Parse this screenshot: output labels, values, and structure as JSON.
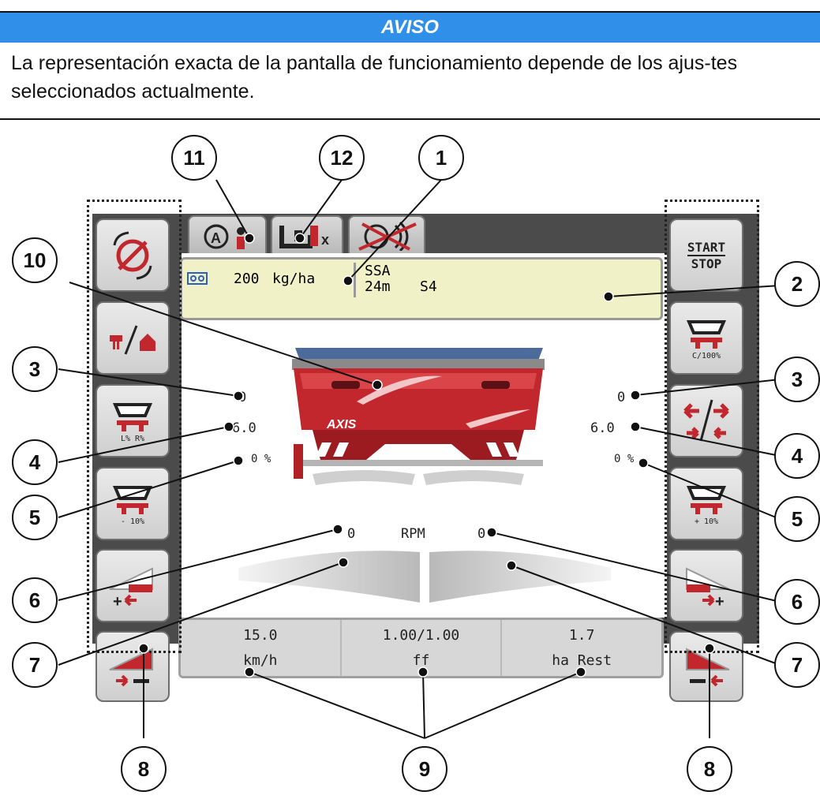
{
  "notice": {
    "title": "AVISO",
    "text": "La representación exacta de la pantalla de funcionamiento depende de los ajus-tes seleccionados actualmente."
  },
  "info_panel": {
    "rate": "200",
    "rate_unit": "kg/ha",
    "fertilizer": "SSA",
    "width": "24m",
    "disc": "S4"
  },
  "left_buttons": [
    {
      "icon": "stop-spinning-discs-icon",
      "label": ""
    },
    {
      "icon": "field-home-switch-icon",
      "label": ""
    },
    {
      "icon": "spreader-left-right-icon",
      "label": "L% R%"
    },
    {
      "icon": "spreader-minus-icon",
      "label": "- 10%"
    },
    {
      "icon": "section-increase-left-icon",
      "label": ""
    },
    {
      "icon": "section-decrease-left-icon",
      "label": ""
    }
  ],
  "right_buttons": [
    {
      "icon": "start-stop-icon",
      "label": "START STOP"
    },
    {
      "icon": "spreader-quantity-reset-icon",
      "label": "C/100%"
    },
    {
      "icon": "direction-switch-icon",
      "label": ""
    },
    {
      "icon": "spreader-plus-icon",
      "label": "+ 10%"
    },
    {
      "icon": "section-increase-right-icon",
      "label": ""
    },
    {
      "icon": "section-decrease-right-icon",
      "label": ""
    }
  ],
  "top_tabs": [
    "gps-automatic-icon",
    "weighing-cell-icon",
    "radar-disabled-icon"
  ],
  "left_values": {
    "row1": "0",
    "row2": "6.0",
    "row3": "0 %"
  },
  "right_values": {
    "row1": "0",
    "row2": "6.0",
    "row3": "0 %"
  },
  "rpm": {
    "left": "0",
    "label": "RPM",
    "right": "0"
  },
  "machine_label": "AXIS",
  "bottom_cells": [
    {
      "value": "15.0",
      "unit": "km/h"
    },
    {
      "value": "1.00/1.00",
      "unit": "ff"
    },
    {
      "value": "1.7",
      "unit": "ha Rest"
    }
  ],
  "callouts": [
    "1",
    "2",
    "3",
    "3",
    "4",
    "4",
    "5",
    "5",
    "6",
    "6",
    "7",
    "7",
    "8",
    "8",
    "9",
    "10",
    "11",
    "12"
  ],
  "colors": {
    "aviso_blue": "#2f8fe9",
    "spreader_red": "#c1272d",
    "info_yellow": "#f1f1c7"
  }
}
